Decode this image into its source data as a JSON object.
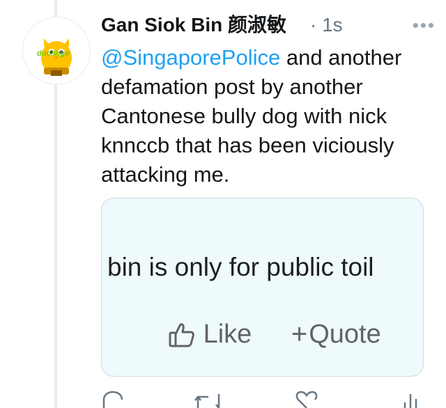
{
  "tweet": {
    "author_name": "Gan Siok Bin 颜淑敏",
    "timestamp": "1s",
    "mention": "@SingaporePolice",
    "body": " and another defamation post by another Cantonese bully dog with nick knnccb that has been viciously attacking me."
  },
  "avatar": {
    "logo_text": "duolingo",
    "color": "#77c800"
  },
  "card": {
    "text": "bin is only for public toil",
    "like_label": "Like",
    "quote_label": "Quote"
  },
  "actions": {
    "icons": [
      "reply-icon",
      "retweet-icon",
      "like-icon",
      "share-icon"
    ]
  }
}
